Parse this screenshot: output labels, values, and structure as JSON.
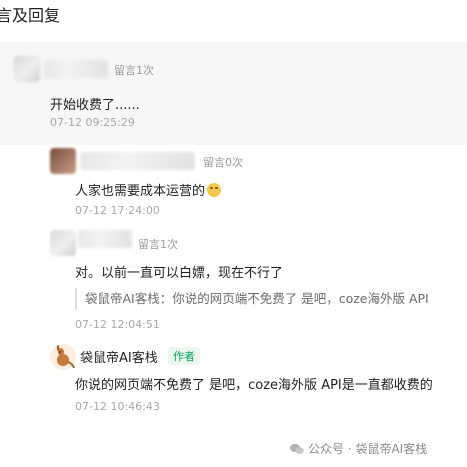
{
  "section_title": "言及回复",
  "comments": [
    {
      "reply_count": "留言1次",
      "text": "开始收费了......",
      "time": "07-12 09:25:29"
    },
    {
      "reply_count": "留言0次",
      "text": "人家也需要成本运营的",
      "emoji": "facepalm-emoji",
      "time": "07-12 17:24:00"
    },
    {
      "reply_count": "留言1次",
      "text": "对。以前一直可以白嫖，现在不行了",
      "quote": "袋鼠帝AI客栈：你说的网页端不免费了 是吧，coze海外版 API",
      "time": "07-12 12:04:51"
    },
    {
      "author_name": "袋鼠帝AI客栈",
      "author_badge": "作者",
      "text": "你说的网页端不免费了 是吧，coze海外版 API是一直都收费的",
      "time": "07-12 10:46:43"
    }
  ],
  "watermark": "公众号 · 袋鼠帝AI客栈",
  "colors": {
    "badge_green": "#07a05b",
    "card_bg": "#f6f6f6"
  }
}
